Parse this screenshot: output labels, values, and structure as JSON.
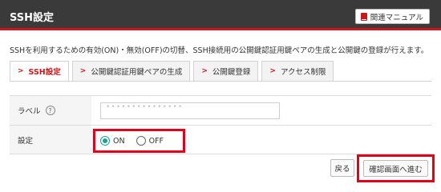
{
  "header": {
    "title": "SSH設定",
    "manual_label": "関連マニュアル",
    "accent_color": "#c9171e"
  },
  "description": "SSHを利用するための有効(ON)・無効(OFF)の切替、SSH接続用の公開鍵認証用鍵ペアの生成と公開鍵の登録が行えます。",
  "tabs": [
    {
      "label": "SSH設定",
      "active": true
    },
    {
      "label": "公開鍵認証用鍵ペアの生成",
      "active": false
    },
    {
      "label": "公開鍵登録",
      "active": false
    },
    {
      "label": "アクセス制限",
      "active": false
    }
  ],
  "form": {
    "label_row": {
      "label": "ラベル",
      "help_icon": "?",
      "value": "•••••••••••••••"
    },
    "setting_row": {
      "label": "設定",
      "options": [
        {
          "label": "ON",
          "checked": true
        },
        {
          "label": "OFF",
          "checked": false
        }
      ]
    }
  },
  "actions": {
    "back_label": "戻る",
    "confirm_label": "確認画面へ進む"
  },
  "colors": {
    "highlight": "#e2001a",
    "radio_checked": "#1aa394"
  }
}
